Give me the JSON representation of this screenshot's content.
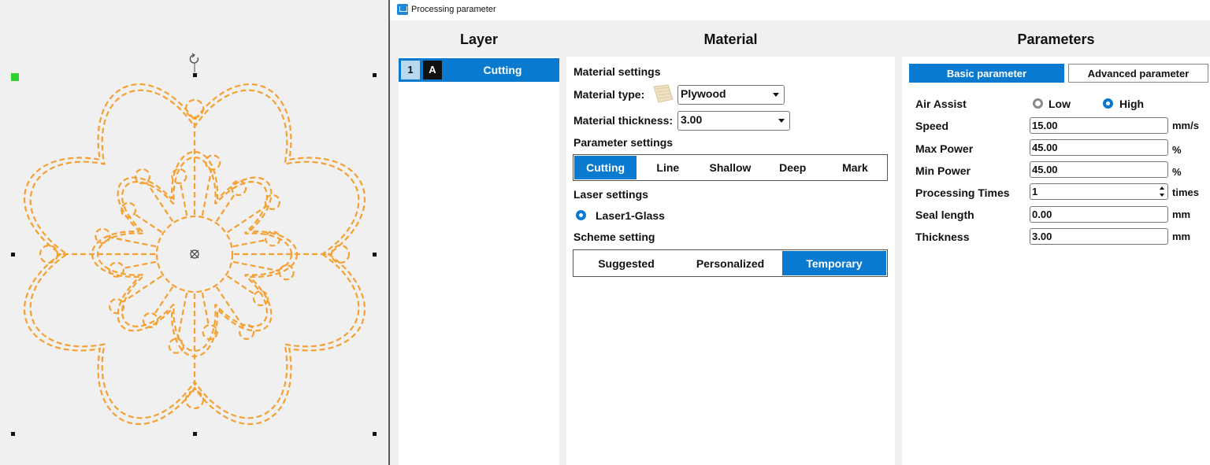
{
  "window": {
    "title": "Processing parameter"
  },
  "columns": {
    "layer": "Layer",
    "material": "Material",
    "parameters": "Parameters"
  },
  "layer": {
    "number": "1",
    "mode": "A",
    "name": "Cutting"
  },
  "material": {
    "section_title": "Material settings",
    "type_label": "Material type:",
    "type_value": "Plywood",
    "type_icon": "plywood-icon",
    "thickness_label": "Material thickness:",
    "thickness_value": "3.00",
    "param_section": "Parameter settings",
    "param_tabs": [
      "Cutting",
      "Line",
      "Shallow",
      "Deep",
      "Mark"
    ],
    "param_active": "Cutting",
    "laser_section": "Laser settings",
    "laser_option": "Laser1-Glass",
    "scheme_section": "Scheme setting",
    "scheme_tabs": [
      "Suggested",
      "Personalized",
      "Temporary"
    ],
    "scheme_active": "Temporary"
  },
  "parameters": {
    "tabs": {
      "basic": "Basic parameter",
      "advanced": "Advanced parameter",
      "active": "basic"
    },
    "air_assist": {
      "label": "Air Assist",
      "options": [
        "Low",
        "High"
      ],
      "selected": "High"
    },
    "speed": {
      "label": "Speed",
      "value": "15.00",
      "unit": "mm/s"
    },
    "max_power": {
      "label": "Max Power",
      "value": "45.00",
      "unit": "%"
    },
    "min_power": {
      "label": "Min Power",
      "value": "45.00",
      "unit": "%"
    },
    "processing_times": {
      "label": "Processing Times",
      "value": "1",
      "unit": "times"
    },
    "seal_length": {
      "label": "Seal length",
      "value": "0.00",
      "unit": "mm"
    },
    "thickness": {
      "label": "Thickness",
      "value": "3.00",
      "unit": "mm"
    }
  },
  "colors": {
    "accent": "#0a7ad0",
    "design_stroke": "#f5a033",
    "handle_green": "#2fd12f"
  },
  "canvas": {
    "rotate_icon": "rotate-handle-icon",
    "center_icon": "center-mark-icon"
  }
}
